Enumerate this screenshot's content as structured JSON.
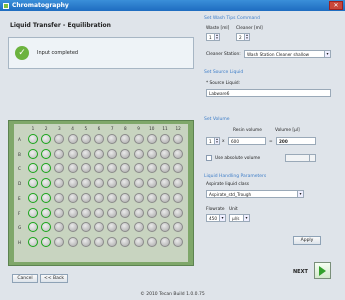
{
  "window": {
    "title": "Chromatography"
  },
  "page": {
    "title": "Liquid Transfer - Equilibration"
  },
  "status": {
    "message": "Input completed"
  },
  "plate": {
    "columns": [
      "1",
      "2",
      "3",
      "4",
      "5",
      "6",
      "7",
      "8",
      "9",
      "10",
      "11",
      "12"
    ],
    "rows": [
      "A",
      "B",
      "C",
      "D",
      "E",
      "F",
      "G",
      "H"
    ],
    "filled_columns": 2,
    "accent": "#19a519"
  },
  "wash": {
    "section": "Set Wash Tips Command",
    "waste_label": "Waste [ml]",
    "cleaner_label": "Cleaner [ml]",
    "waste_value": "1",
    "cleaner_value": "2",
    "station_label": "Cleaner Station:",
    "station_value": "Wash Station Cleaner shallow"
  },
  "source": {
    "section": "Set Source Liquid",
    "label": "* Source Liquid:",
    "value": "Labware6"
  },
  "volume": {
    "section": "Set Volume",
    "resin_label": "Resin volume",
    "volume_label": "Volume [µl]",
    "factor": "1",
    "times": "x",
    "resin_value": "600",
    "equals": "=",
    "volume_value": "200",
    "absolute_label": "Use absolute volume"
  },
  "liquid_params": {
    "section": "Liquid Handling Parameters",
    "aspirate_label": "Aspirate liquid class",
    "aspirate_value": "Aspirate_std_Trough",
    "flowrate_label": "Flowrate",
    "unit_label": "Unit",
    "flowrate_value": "450",
    "unit_value": "µl/s"
  },
  "buttons": {
    "apply": "Apply",
    "cancel": "Cancel",
    "back": "<< Back",
    "next": "NEXT"
  },
  "footer": {
    "text": "© 2010 Tecan  Build 1.0.0.75"
  }
}
